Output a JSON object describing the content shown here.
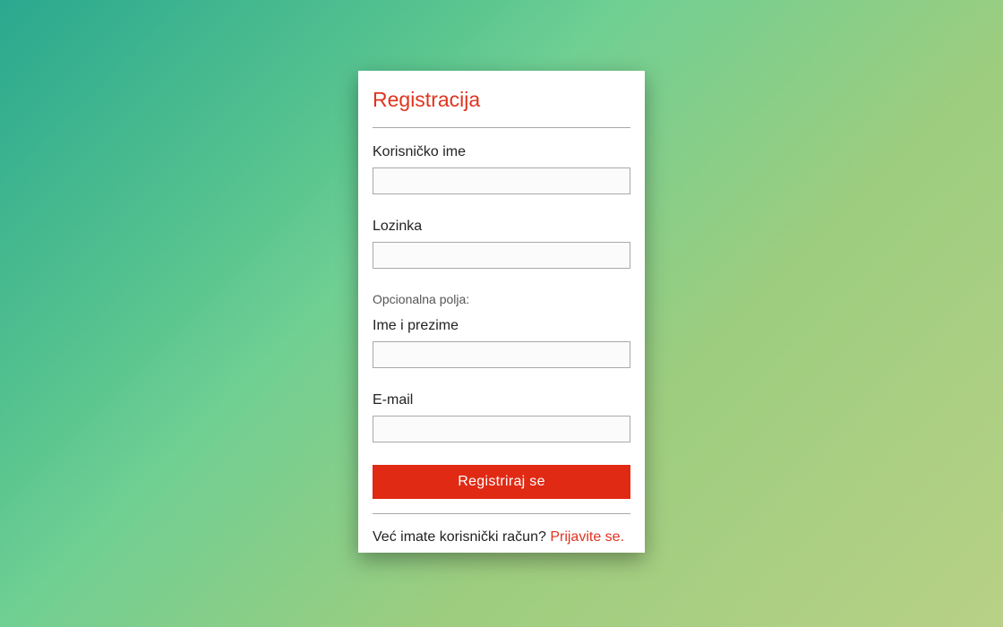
{
  "form": {
    "title": "Registracija",
    "fields": {
      "username": {
        "label": "Korisničko ime",
        "value": ""
      },
      "password": {
        "label": "Lozinka",
        "value": ""
      },
      "optional_heading": "Opcionalna polja:",
      "fullname": {
        "label": "Ime i prezime",
        "value": ""
      },
      "email": {
        "label": "E-mail",
        "value": ""
      }
    },
    "submit_label": "Registriraj se",
    "footer": {
      "text": "Već imate korisnički račun?",
      "link_label": "Prijavite se."
    }
  },
  "colors": {
    "accent": "#e0341f",
    "button": "#e02a14",
    "background_start": "#2aa88f",
    "background_end": "#b8d186"
  }
}
